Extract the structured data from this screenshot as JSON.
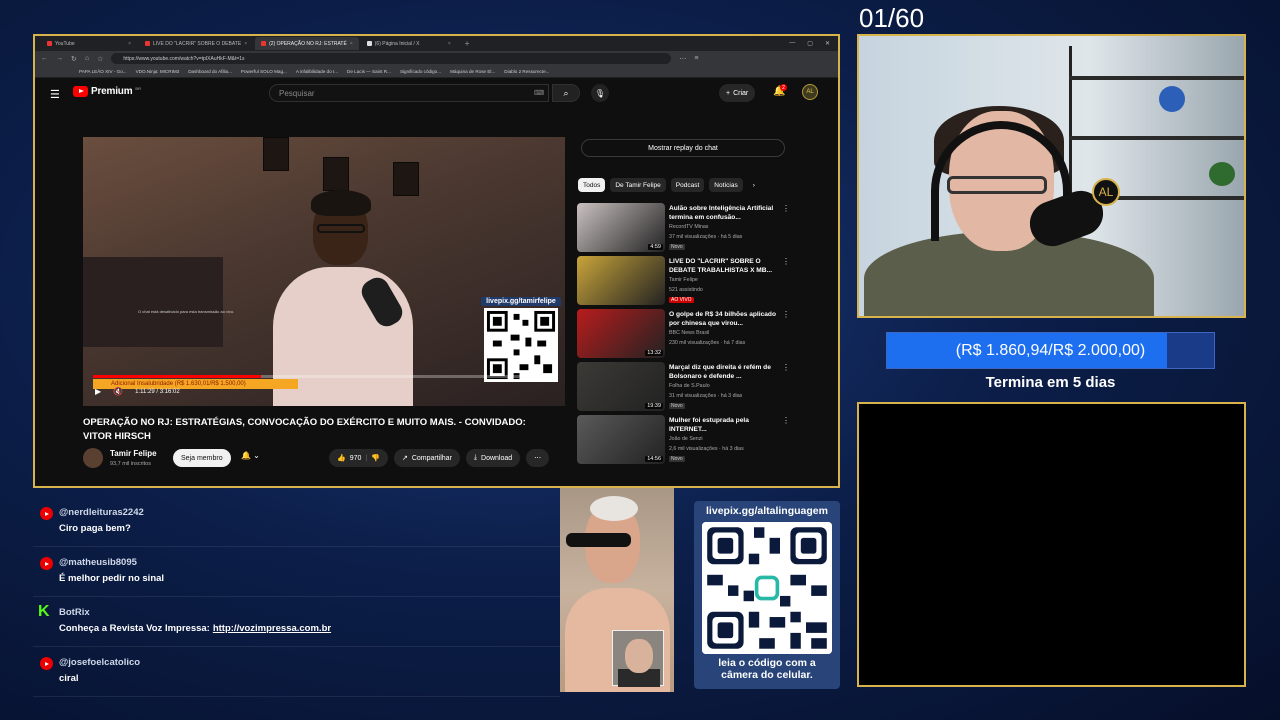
{
  "overlay": {
    "counter": "01/60",
    "goal_text": "(R$ 1.860,94/R$ 2.000,00)",
    "goal_progress": 0.9305,
    "ends_text": "Termina em 5 dias",
    "qr_url": "livepix.gg/altalinguagem",
    "qr_caption_1": "leia o código com a",
    "qr_caption_2": "câmera do celular."
  },
  "browser": {
    "tabs": [
      {
        "label": "YouTube",
        "active": false
      },
      {
        "label": "LIVE DO \"LACRIR\" SOBRE O DEBATE",
        "active": false
      },
      {
        "label": "(2) OPERAÇÃO NO RJ: ESTRATÉ",
        "active": true
      },
      {
        "label": "(6) Página Inicial / X",
        "active": false
      }
    ],
    "url": "https://www.youtube.com/watch?v=tpIXAuHkF-M&t=1s",
    "bookmarks": [
      "PAPA LEÃO XIV - Go...",
      "VDO.Ninja: MICRIM3",
      "Dashboard do Afilia...",
      "Powerful SOLO Mag...",
      "A infalibilidade do I...",
      "De Lacis — Saint R...",
      "Significado código...",
      "Máquina de Rose El...",
      "Diablo 2 Ressurecte..."
    ]
  },
  "youtube": {
    "logo": "Premium",
    "region": "BR",
    "search_placeholder": "Pesquisar",
    "create_label": "Criar",
    "notif_count": "2",
    "avatar_text": "AL",
    "player": {
      "qr_url": "livepix.gg/tamirfelipe",
      "goal_text": "Adicional Insalubridade (R$ 1.630,01/R$ 1.500,00)",
      "chat_hint": "O chat está desativado para esta transmissão ao vivo.",
      "time": "1:11:29 / 3:16:02",
      "progress": 0.364
    },
    "title": "OPERAÇÃO NO RJ: ESTRATÉGIAS, CONVOCAÇÃO DO EXÉRCITO E MUITO MAIS. - CONVIDADO: VITOR HIRSCH",
    "channel": {
      "name": "Tamir Felipe",
      "subs": "93,7 mil inscritos",
      "join": "Seja membro"
    },
    "actions": {
      "likes": "970",
      "share": "Compartilhar",
      "download": "Download"
    },
    "replay_chat": "Mostrar replay do chat",
    "chips": [
      "Todos",
      "De Tamir Felipe",
      "Podcast",
      "Notícias"
    ],
    "related": [
      {
        "title": "Aulão sobre Inteligência Artificial termina em confusão...",
        "channel": "RecordTV Minas",
        "meta": "37 mil visualizações · há 5 dias",
        "badge": "Novo",
        "duration": "4:59",
        "color": "#c9c1c0"
      },
      {
        "title": "LIVE DO \"LACRIR\" SOBRE O DEBATE TRABALHISTAS X MB...",
        "channel": "Tamir Felipe",
        "meta": "521 assistindo",
        "badge": "AO VIVO",
        "duration": "",
        "color": "#c8a43a"
      },
      {
        "title": "O golpe de R$ 34 bilhões aplicado por chinesa que virou...",
        "channel": "BBC News Brasil",
        "meta": "230 mil visualizações · há 7 dias",
        "badge": "",
        "duration": "13:32",
        "color": "#b81c1c"
      },
      {
        "title": "Marçal diz que direita é refém de Bolsonaro e defende ...",
        "channel": "Folha de S.Paulo",
        "meta": "31 mil visualizações · há 3 dias",
        "badge": "Novo",
        "duration": "19:39",
        "color": "#3b3a36"
      },
      {
        "title": "Mulher foi estuprada pela INTERNET...",
        "channel": "João de Senzi",
        "meta": "2,6 mil visualizações · há 3 dias",
        "badge": "Novo",
        "duration": "14:56",
        "color": "#5a5a5a"
      }
    ]
  },
  "chat": [
    {
      "platform": "youtube",
      "user": "@nerdleituras2242",
      "text": "Ciro paga bem?",
      "link": ""
    },
    {
      "platform": "youtube",
      "user": "@matheusib8095",
      "text": "É melhor pedir no sinal",
      "link": ""
    },
    {
      "platform": "kick",
      "user": "BotRix",
      "text": "Conheça a Revista Voz Impressa:",
      "link": "http://vozimpressa.com.br"
    },
    {
      "platform": "youtube",
      "user": "@josefoelcatolico",
      "text": "ciral",
      "link": ""
    }
  ]
}
